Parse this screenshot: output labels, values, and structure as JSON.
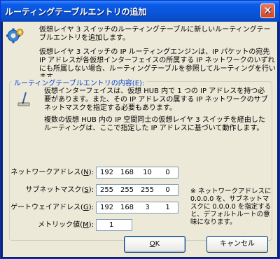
{
  "window": {
    "title": "ルーティングテーブルエントリの追加",
    "close_glyph": "✕"
  },
  "intro": {
    "p1": "仮想レイヤ 3 スイッチのルーティングテーブルに新しいルーティングテーブルエントリを追加します。",
    "p2": "仮想レイヤ 3 スイッチの IP ルーティングエンジンは、IP パケットの宛先 IP アドレスが各仮想インターフェイスの所属する IP ネットワークのいずれにも所属しない場合、ルーティングテーブルを参照してルーティングを行います。"
  },
  "group": {
    "legend": "ルーティングテーブルエントリの内容(E):",
    "p3": "仮想インターフェイスは、仮想 HUB 内で 1 つの IP アドレスを持つ必要があります。また、その IP アドレスの属する IP ネットワークのサブネットマスクを指定する必要もあります。",
    "p4": "複数の仮想 HUB 内の IP 空間同士の仮想レイヤ 3 スイッチを経由したルーティングは、ここで指定した IP アドレスに基づいて動作します。"
  },
  "fields": {
    "network": {
      "label": "ネットワークアドレス(",
      "key": "N",
      "label_end": "):",
      "octets": [
        "192",
        "168",
        "10",
        "0"
      ]
    },
    "subnet": {
      "label": "サブネットマスク(",
      "key": "S",
      "label_end": "):",
      "octets": [
        "255",
        "255",
        "255",
        "0"
      ]
    },
    "gateway": {
      "label": "ゲートウェイアドレス(",
      "key": "G",
      "label_end": "):",
      "octets": [
        "192",
        "168",
        "3",
        "1"
      ]
    },
    "metric": {
      "label": "メトリック値(",
      "key": "M",
      "label_end": "):",
      "value": "1"
    }
  },
  "note": "※ ネットワークアドレスに 0.0.0.0 を、サブネットマスクに 0.0.0.0 を指定すると、デフォルトルートの意味になります。",
  "buttons": {
    "ok_key": "O",
    "ok_label": "K",
    "cancel": "キャンセル"
  },
  "colors": {
    "titlebar": "#0a56de",
    "dialog_bg": "#ece9d8",
    "legend_text": "#0046d5",
    "close_button": "#d6451f"
  },
  "icons": {
    "header": "gears-icon",
    "info": "pen-note-icon"
  }
}
